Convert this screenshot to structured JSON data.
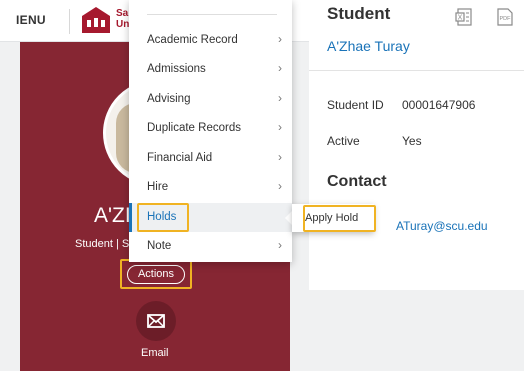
{
  "header": {
    "menu_label": "IENU",
    "logo_line1": "Sar",
    "logo_line2": "Un"
  },
  "profile": {
    "name": "A'ZI",
    "subtitle": "Student | S",
    "actions_label": "Actions",
    "email_label": "Email",
    "panel_color": "#862633"
  },
  "dropdown": {
    "items": [
      {
        "label": "Academic Record",
        "chevron": "›"
      },
      {
        "label": "Admissions",
        "chevron": "›"
      },
      {
        "label": "Advising",
        "chevron": "›"
      },
      {
        "label": "Duplicate Records",
        "chevron": "›"
      },
      {
        "label": "Financial Aid",
        "chevron": "›"
      },
      {
        "label": "Hire",
        "chevron": "›"
      },
      {
        "label": "Holds",
        "chevron": ""
      },
      {
        "label": "Note",
        "chevron": "›"
      }
    ],
    "active_item": "Holds",
    "submenu_item": "Apply Hold"
  },
  "card": {
    "title": "Student",
    "student_name": "A'Zhae Turay",
    "fields": [
      {
        "label": "Student ID",
        "value": "00001647906"
      },
      {
        "label": "Active",
        "value": "Yes"
      }
    ],
    "contact_title": "Contact",
    "email": "ATuray@scu.edu",
    "icons": [
      "excel-export-icon",
      "pdf-export-icon"
    ],
    "pdf_label": "PDF"
  },
  "colors": {
    "accent": "#1a73b8",
    "highlight": "#f0b323",
    "brand": "#a6192e"
  }
}
